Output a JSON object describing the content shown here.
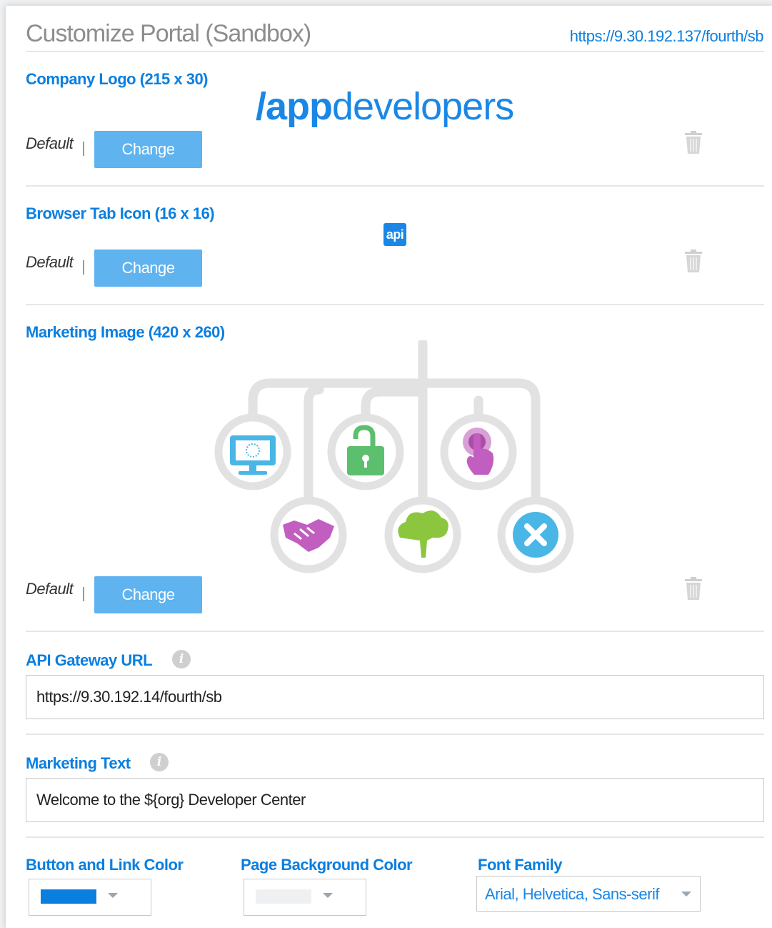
{
  "page": {
    "title": "Customize Portal (Sandbox)",
    "portal_url": "https://9.30.192.137/fourth/sb"
  },
  "company_logo": {
    "label": "Company Logo (215 x 30)",
    "preview_bold": "/app",
    "preview_light": "developers",
    "default_label": "Default",
    "change_label": "Change"
  },
  "browser_tab_icon": {
    "label": "Browser Tab Icon (16 x 16)",
    "preview_text": "api",
    "default_label": "Default",
    "change_label": "Change"
  },
  "marketing_image": {
    "label": "Marketing Image (420 x 260)",
    "default_label": "Default",
    "change_label": "Change",
    "icons": [
      "monitor-icon",
      "unlock-icon",
      "pointer-icon",
      "handshake-icon",
      "cloud-icon",
      "close-x-icon"
    ]
  },
  "api_gateway": {
    "label": "API Gateway URL",
    "value": "https://9.30.192.14/fourth/sb"
  },
  "marketing_text": {
    "label": "Marketing Text",
    "value": "Welcome to the ${org} Developer Center"
  },
  "colors": {
    "button_link_label": "Button and Link Color",
    "button_link_value": "#0a7fe0",
    "page_bg_label": "Page Background Color",
    "page_bg_value": "#eef0f2",
    "accent": "#0a7fe0",
    "button_bg": "#5fb3ef"
  },
  "font_family": {
    "label": "Font Family",
    "value": "Arial, Helvetica, Sans-serif"
  }
}
